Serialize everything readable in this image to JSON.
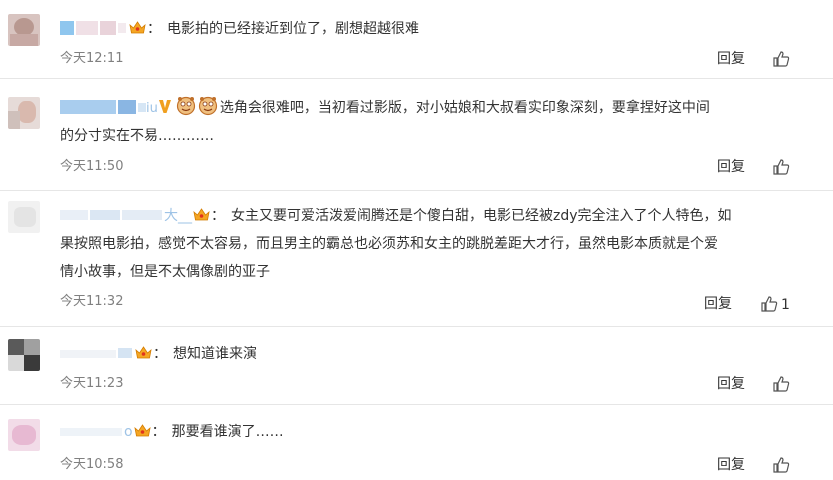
{
  "comments": [
    {
      "text": "电影拍的已经接近到位了，剧想超越很难",
      "time": "今天12:11",
      "reply": "回复"
    },
    {
      "username_suffix": "iu",
      "line1": "选角会很难吧，当初看过影版，对小姑娘和大叔看实印象深刻，要拿捏好这中间",
      "line2": "的分寸实在不易…………",
      "time": "今天11:50",
      "reply": "回复"
    },
    {
      "username_suffix": "大__",
      "line1": "女主又要可爱活泼爱闹腾还是个傻白甜，电影已经被zdy完全注入了个人特色，如",
      "line2": "果按照电影拍，感觉不太容易，而且男主的霸总也必须苏和女主的跳脱差距大才行，虽然电影本质就是个爱",
      "line3": "情小故事，但是不太偶像剧的亚子",
      "time": "今天11:32",
      "reply": "回复",
      "likes": "1"
    },
    {
      "text": "想知道谁来演",
      "time": "今天11:23",
      "reply": "回复"
    },
    {
      "username_suffix": "o",
      "text": "那要看谁演了……",
      "time": "今天10:58",
      "reply": "回复"
    }
  ],
  "colors": {
    "text": "#333333",
    "time": "#808080",
    "divider": "#e6e6e6",
    "crown": "#f5a623",
    "vbadge": "#f0a020",
    "username_blur": "#9ec3e6"
  },
  "icons": [
    "crown-icon",
    "v-badge-icon",
    "doge-emoji-icon",
    "thumbs-up-icon"
  ]
}
